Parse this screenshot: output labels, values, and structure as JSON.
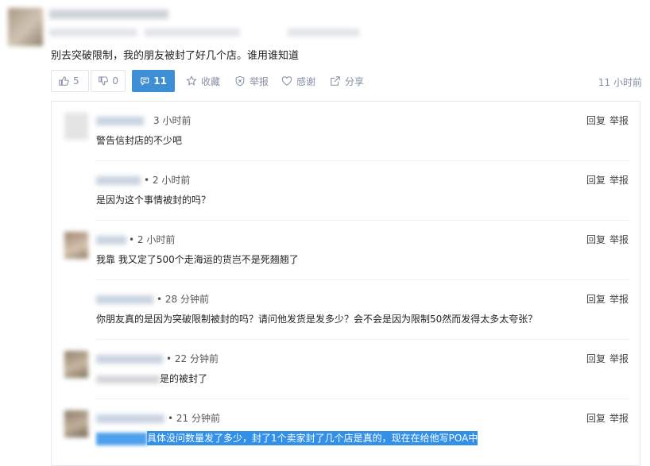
{
  "post": {
    "text": "别去突破限制，我的朋友被封了好几个店。谁用谁知道",
    "time": "11 小时前"
  },
  "actions": {
    "like_count": "5",
    "dislike_count": "0",
    "comment_count": "11",
    "favorite": "收藏",
    "report": "举报",
    "thanks": "感谢",
    "share": "分享"
  },
  "comments": [
    {
      "time": "3 小时前",
      "text": "警告信封店的不少吧",
      "reply": "回复",
      "report": "举报"
    },
    {
      "time": "• 2 小时前",
      "text": "是因为这个事情被封的吗？",
      "reply": "回复",
      "report": "举报"
    },
    {
      "time": "• 2 小时前",
      "text": "我靠 我又定了500个走海运的货岂不是死翘翘了",
      "reply": "回复",
      "report": "举报"
    },
    {
      "time": "• 28 分钟前",
      "text": "你朋友真的是因为突破限制被封的吗？请问他发货是发多少？会不会是因为限制50然而发得太多太夸张？",
      "reply": "回复",
      "report": "举报"
    },
    {
      "time": "• 22 分钟前",
      "text": "是的被封了",
      "reply": "回复",
      "report": "举报"
    },
    {
      "time": "• 21 分钟前",
      "text": "具体没问数量发了多少，封了1个卖家封了几个店是真的，现在在给他写POA中",
      "reply": "回复",
      "report": "举报"
    }
  ]
}
